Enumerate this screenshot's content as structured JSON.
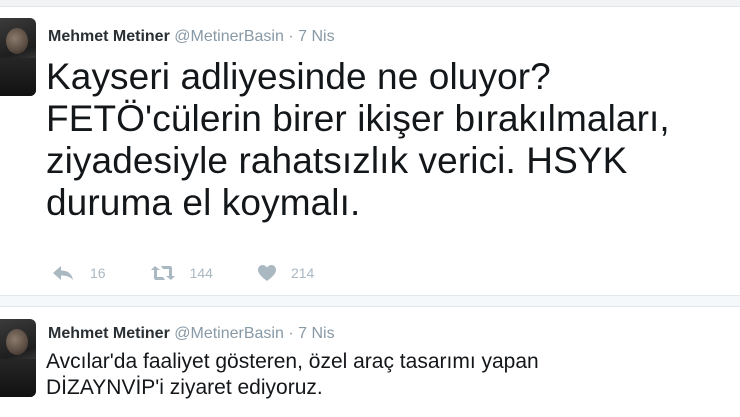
{
  "tweets": [
    {
      "name": "Mehmet Metiner",
      "handle": "@MetinerBasin",
      "separator": "·",
      "date": "7 Nis",
      "text_lines": [
        "Kayseri adliyesinde ne oluyor?",
        "FETÖ'cülerin birer ikişer bırakılmaları,",
        "ziyadesiyle rahatsızlık verici. HSYK",
        "duruma el koymalı."
      ],
      "actions": {
        "reply_icon": "reply-icon",
        "reply_count": "16",
        "retweet_icon": "retweet-icon",
        "retweet_count": "144",
        "like_icon": "heart-icon",
        "like_count": "214"
      }
    },
    {
      "name": "Mehmet Metiner",
      "handle": "@MetinerBasin",
      "separator": "·",
      "date": "7 Nis",
      "text_lines": [
        "Avcılar'da faaliyet gösteren, özel araç tasarımı yapan",
        "DİZAYNVİP'i ziyaret ediyoruz."
      ]
    }
  ],
  "colors": {
    "text": "#14171a",
    "muted": "#8899a6",
    "icon": "#aab8c2",
    "divider": "#e1e8ed"
  }
}
